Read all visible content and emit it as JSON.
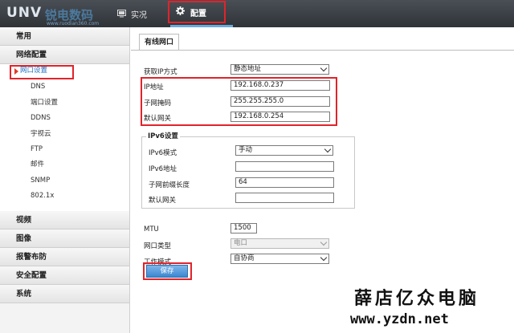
{
  "app": {
    "logo": "UNV",
    "watermark_top": "锐电数码",
    "watermark_url": "www.ruodian360.com"
  },
  "topnav": {
    "live_label": "实况",
    "config_label": "配置"
  },
  "sidebar": {
    "sections": [
      "常用",
      "网络配置",
      "视频",
      "图像",
      "报警布防",
      "安全配置",
      "系统"
    ],
    "network_items": [
      "网口设置",
      "DNS",
      "端口设置",
      "DDNS",
      "宇视云",
      "FTP",
      "邮件",
      "SNMP",
      "802.1x"
    ]
  },
  "main": {
    "tab_label": "有线网口",
    "ip_mode_label": "获取IP方式",
    "ip_mode_value": "静态地址",
    "ip_label": "IP地址",
    "ip_value": "192.168.0.237",
    "mask_label": "子网掩码",
    "mask_value": "255.255.255.0",
    "gateway_label": "默认网关",
    "gateway_value": "192.168.0.254",
    "ipv6": {
      "legend": "IPv6设置",
      "mode_label": "IPv6模式",
      "mode_value": "手动",
      "addr_label": "IPv6地址",
      "addr_value": "",
      "prefix_label": "子网前缀长度",
      "prefix_value": "64",
      "gateway_label": "默认网关",
      "gateway_value": ""
    },
    "mtu_label": "MTU",
    "mtu_value": "1500",
    "port_type_label": "网口类型",
    "port_type_value": "电口",
    "work_mode_label": "工作模式",
    "work_mode_value": "自协商",
    "save_label": "保存"
  },
  "watermark": {
    "cn": "薛店亿众电脑",
    "url": "www.yzdn.net"
  },
  "colors": {
    "highlight": "#e0242b",
    "accent": "#3c86cf",
    "active_text": "#1f6fbf"
  },
  "icons": {
    "live": "monitor-icon",
    "config": "gear-icon",
    "active_item": "arrow-right-icon"
  }
}
